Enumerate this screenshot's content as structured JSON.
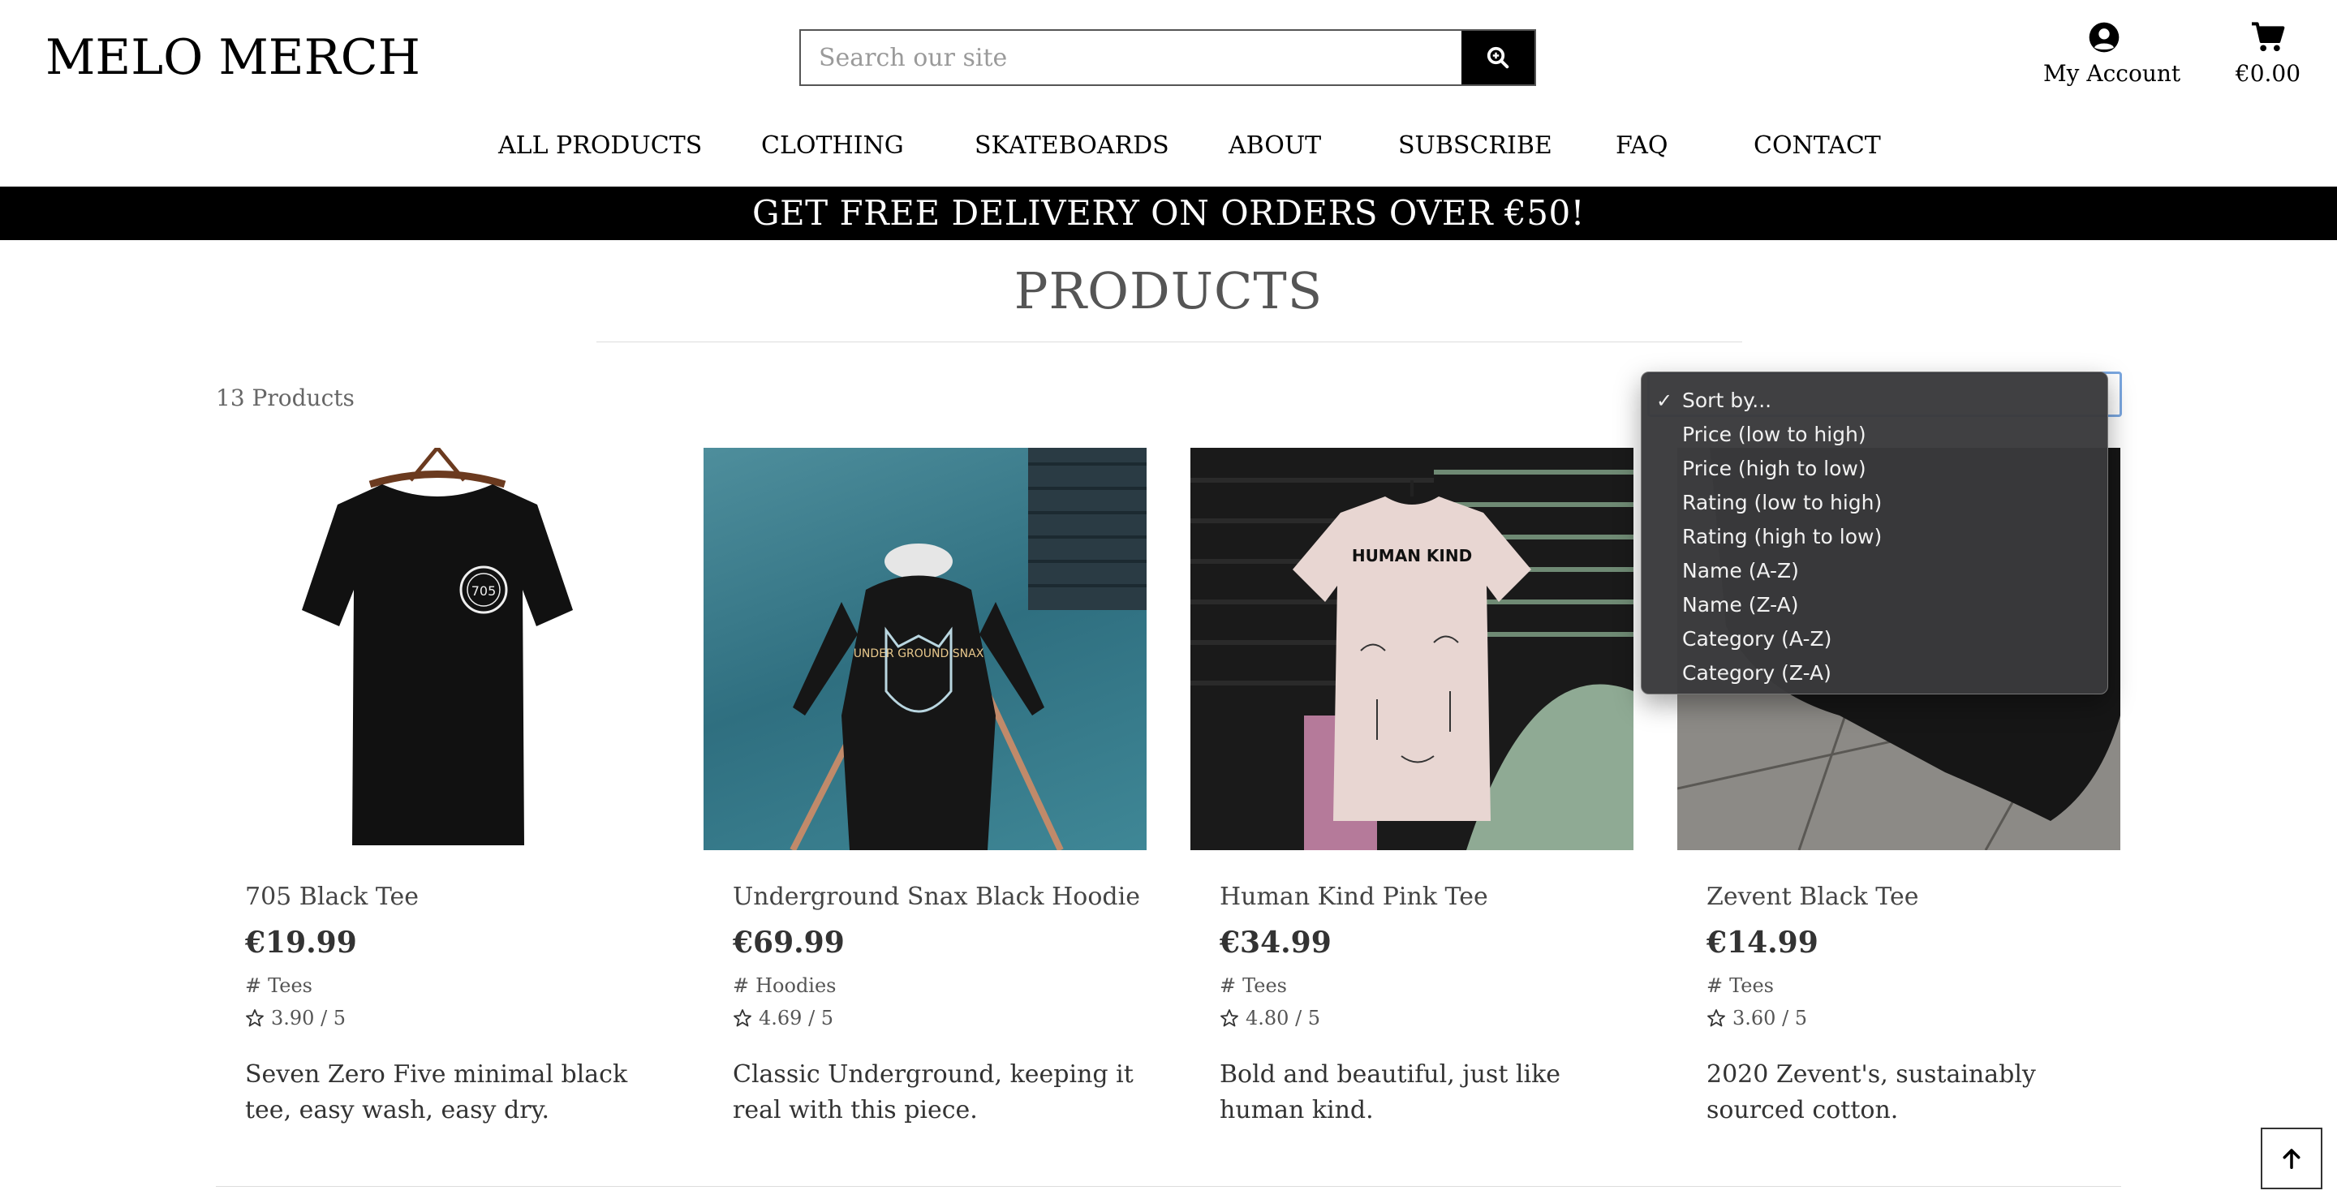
{
  "header": {
    "logo": "MELO MERCH",
    "search_placeholder": "Search our site",
    "account_label": "My Account",
    "cart_total": "€0.00"
  },
  "nav": {
    "items": [
      "ALL PRODUCTS",
      "CLOTHING",
      "SKATEBOARDS",
      "ABOUT",
      "SUBSCRIBE",
      "FAQ",
      "CONTACT"
    ]
  },
  "banner": "GET FREE DELIVERY ON ORDERS OVER €50!",
  "page_title": "PRODUCTS",
  "product_count": "13 Products",
  "sort": {
    "options": [
      "Sort by...",
      "Price (low to high)",
      "Price (high to low)",
      "Rating (low to high)",
      "Rating (high to low)",
      "Name (A-Z)",
      "Name (Z-A)",
      "Category (A-Z)",
      "Category (Z-A)"
    ],
    "selected": "Sort by..."
  },
  "products": [
    {
      "name": "705 Black Tee",
      "price": "€19.99",
      "category": "Tees",
      "rating": "3.90 / 5",
      "description": "Seven Zero Five minimal black tee, easy wash, easy dry.",
      "image_print": "705"
    },
    {
      "name": "Underground Snax Black Hoodie",
      "price": "€69.99",
      "category": "Hoodies",
      "rating": "4.69 / 5",
      "description": "Classic Underground, keeping it real with this piece.",
      "image_print": "UNDER GROUND SNAX"
    },
    {
      "name": "Human Kind Pink Tee",
      "price": "€34.99",
      "category": "Tees",
      "rating": "4.80 / 5",
      "description": "Bold and beautiful, just like human kind.",
      "image_print": "HUMAN KIND"
    },
    {
      "name": "Zevent Black Tee",
      "price": "€14.99",
      "category": "Tees",
      "rating": "3.60 / 5",
      "description": "2020 Zevent's, sustainably sourced cotton.",
      "image_print": ""
    }
  ],
  "colors": {
    "banner_bg": "#000000",
    "text": "#000000",
    "dropdown_bg": "#3a3a3c",
    "focus_ring": "#7aa7e0"
  }
}
